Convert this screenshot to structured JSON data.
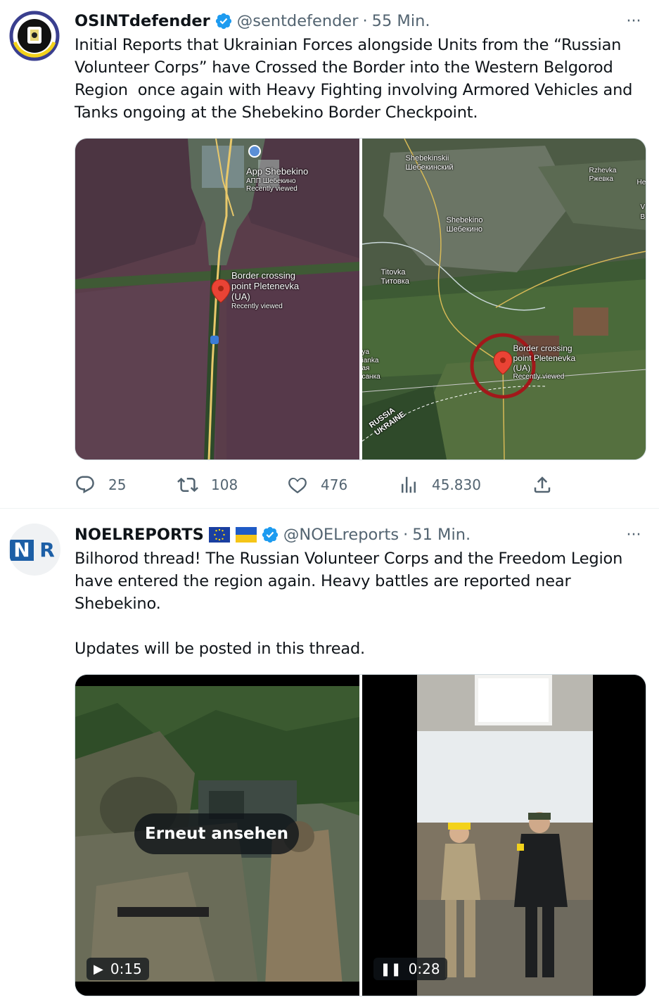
{
  "tweets": [
    {
      "display_name": "OSINTdefender",
      "handle": "@sentdefender",
      "separator": "·",
      "time": "55 Min.",
      "more": "···",
      "text": "Initial Reports that Ukrainian Forces alongside Units from the “Russian Volunteer Corps” have Crossed the Border into the Western Belgorod Region  once again with Heavy Fighting involving Armored Vehicles and Tanks ongoing at the Shebekino Border Checkpoint.",
      "media": {
        "map_left": {
          "poi_1": {
            "name": "App Shebekino",
            "name_ru": "АПП Шебекино",
            "sub": "Recently viewed"
          },
          "poi_2": {
            "line1": "Border crossing",
            "line2": "point Pletenevka",
            "line3": "(UA)",
            "sub": "Recently viewed"
          }
        },
        "map_right": {
          "shebekinskii": "Shebekinskii",
          "shebekinskii_ru": "Шебекинский",
          "rzhevka": "Rzhevka",
          "rzhevka_ru": "Ржевка",
          "shebekino": "Shebekino",
          "shebekino_ru": "Шебекино",
          "titovka": "Titovka",
          "titovka_ru": "Титовка",
          "edge_he": "He",
          "edge_v": "V",
          "edge_b": "B",
          "partial_1": "ya",
          "partial_2": "ianka",
          "partial_3": "ая",
          "partial_4": "санка",
          "poi": {
            "line1": "Border crossing",
            "line2": "point Pletenevka",
            "line3": "(UA)",
            "sub": "Recently viewed"
          },
          "border_1": "RUSSIA",
          "border_2": "UKRAINE"
        }
      },
      "actions": {
        "replies": "25",
        "reposts": "108",
        "likes": "476",
        "views": "45.830"
      },
      "colors": {
        "accent": "#1d9bf0"
      }
    },
    {
      "display_name": "NOELREPORTS",
      "handle": "@NOELreports",
      "separator": "·",
      "time": "51 Min.",
      "more": "···",
      "avatar_text_n": "N",
      "avatar_text_r": "R",
      "text": "Bilhorod thread! The Russian Volunteer Corps and the Freedom Legion have entered the region again. Heavy battles are reported near Shebekino.\n\nUpdates will be posted in this thread.",
      "media": {
        "video_left": {
          "overlay": "Erneut ansehen",
          "duration": "0:15"
        },
        "video_right": {
          "duration": "0:28"
        }
      }
    }
  ]
}
